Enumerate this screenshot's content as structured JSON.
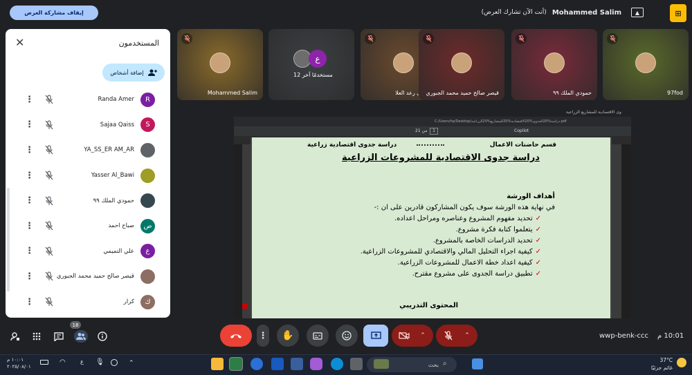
{
  "topbar": {
    "stop_share_label": "إيقاف مشاركة العرض",
    "sharing_status": "(أنت الآن تشارك العرض)",
    "presenter_name": "Mohammed Salim"
  },
  "panel": {
    "title": "المستخدمون",
    "add_people_label": "إضافة أشخاص",
    "participants": [
      {
        "name": "Randa Amer",
        "initial": "R",
        "color": "#7b1fa2"
      },
      {
        "name": "Sajaa Qaiss",
        "initial": "S",
        "color": "#c2185b"
      },
      {
        "name": "YA_SS_ER AM_AR",
        "initial": "",
        "color": "#5f6368"
      },
      {
        "name": "Yasser Al_Bawi",
        "initial": "",
        "color": "#9e9d24"
      },
      {
        "name": "حمودي الملك ٩٩",
        "initial": "",
        "color": "#37474f"
      },
      {
        "name": "صباح احمد",
        "initial": "ص",
        "color": "#00796b"
      },
      {
        "name": "علي التميمي",
        "initial": "ع",
        "color": "#7b1fa2"
      },
      {
        "name": "قيصر صالح حميد محمد الجبوري",
        "initial": "",
        "color": "#8d6e63"
      },
      {
        "name": "كرار",
        "initial": "ك",
        "color": "#8d6e63"
      }
    ]
  },
  "tiles": [
    {
      "name": "Mohammed Salim",
      "bg": "#8a6a2a"
    },
    {
      "name": "12 مستخدمًا آخر",
      "bg": "#3c4043"
    },
    {
      "name": "مرتضى رعد العلا ...",
      "bg": "#6b4a2e"
    },
    {
      "name": "قيصر صالح حميد محمد الجبوري",
      "bg": "#6e2a2a"
    },
    {
      "name": "حمودي الملك ٩٩",
      "bg": "#7a2a3a"
    },
    {
      "name": "97fod",
      "bg": "#5a6a2a"
    }
  ],
  "others_initial": "ع",
  "screen": {
    "tab_title": "دراسة الجدوى الاقتصادية للمشاريع الزراعية.pdf",
    "address": "C:/Users/hp/Desktop/دراسة%20الجدوى%20الاقتصادية%20للمشاريع%20الزراعية.pdf",
    "page_info": "من 21",
    "page_num": "1",
    "copilot": "Copilot",
    "doc": {
      "header_right": "قسم حاضنات الاعمال",
      "header_left": "دراسة جدوى اقتصادية زراعية",
      "title": "دراسة جدوى الاقتصادية للمشروعات الزراعية",
      "section": "أهداف الورشة",
      "intro": "في نهاية هذه الورشة سوف يكون المشاركون قادرين على ان :-",
      "bullets": [
        "تحديد مفهوم المشروع وعناصره ومراحل اعداده.",
        "يتعلموا كتابة فكرة مشروع.",
        "تحديد الدراسات الخاصة بالمشروع.",
        "كيفية اجراء التحليل المالي والاقتصادي للمشروعات الزراعية.",
        "كيفية اعداد خطة الاعمال للمشروعات الزراعية.",
        "تطبيق دراسة الجدوى على مشروع مقترح."
      ],
      "section2": "المحتوى التدريبي"
    }
  },
  "controls": {
    "people_count": "18",
    "meeting_code": "wwp-benk-ccc",
    "time": "10:01 م"
  },
  "taskbar": {
    "search_label": "بحث",
    "temperature": "37°C",
    "weather": "غائم جزئيًا",
    "tray_time": "١٠:٠١ م",
    "tray_date": "٢٠٢٥/٠٨/٠١",
    "lang": "ع"
  },
  "colors": {
    "accent": "#a8c7fa",
    "end_call": "#ea4335",
    "mute_red": "#8c1d18",
    "present_active": "#a8c7fa"
  }
}
